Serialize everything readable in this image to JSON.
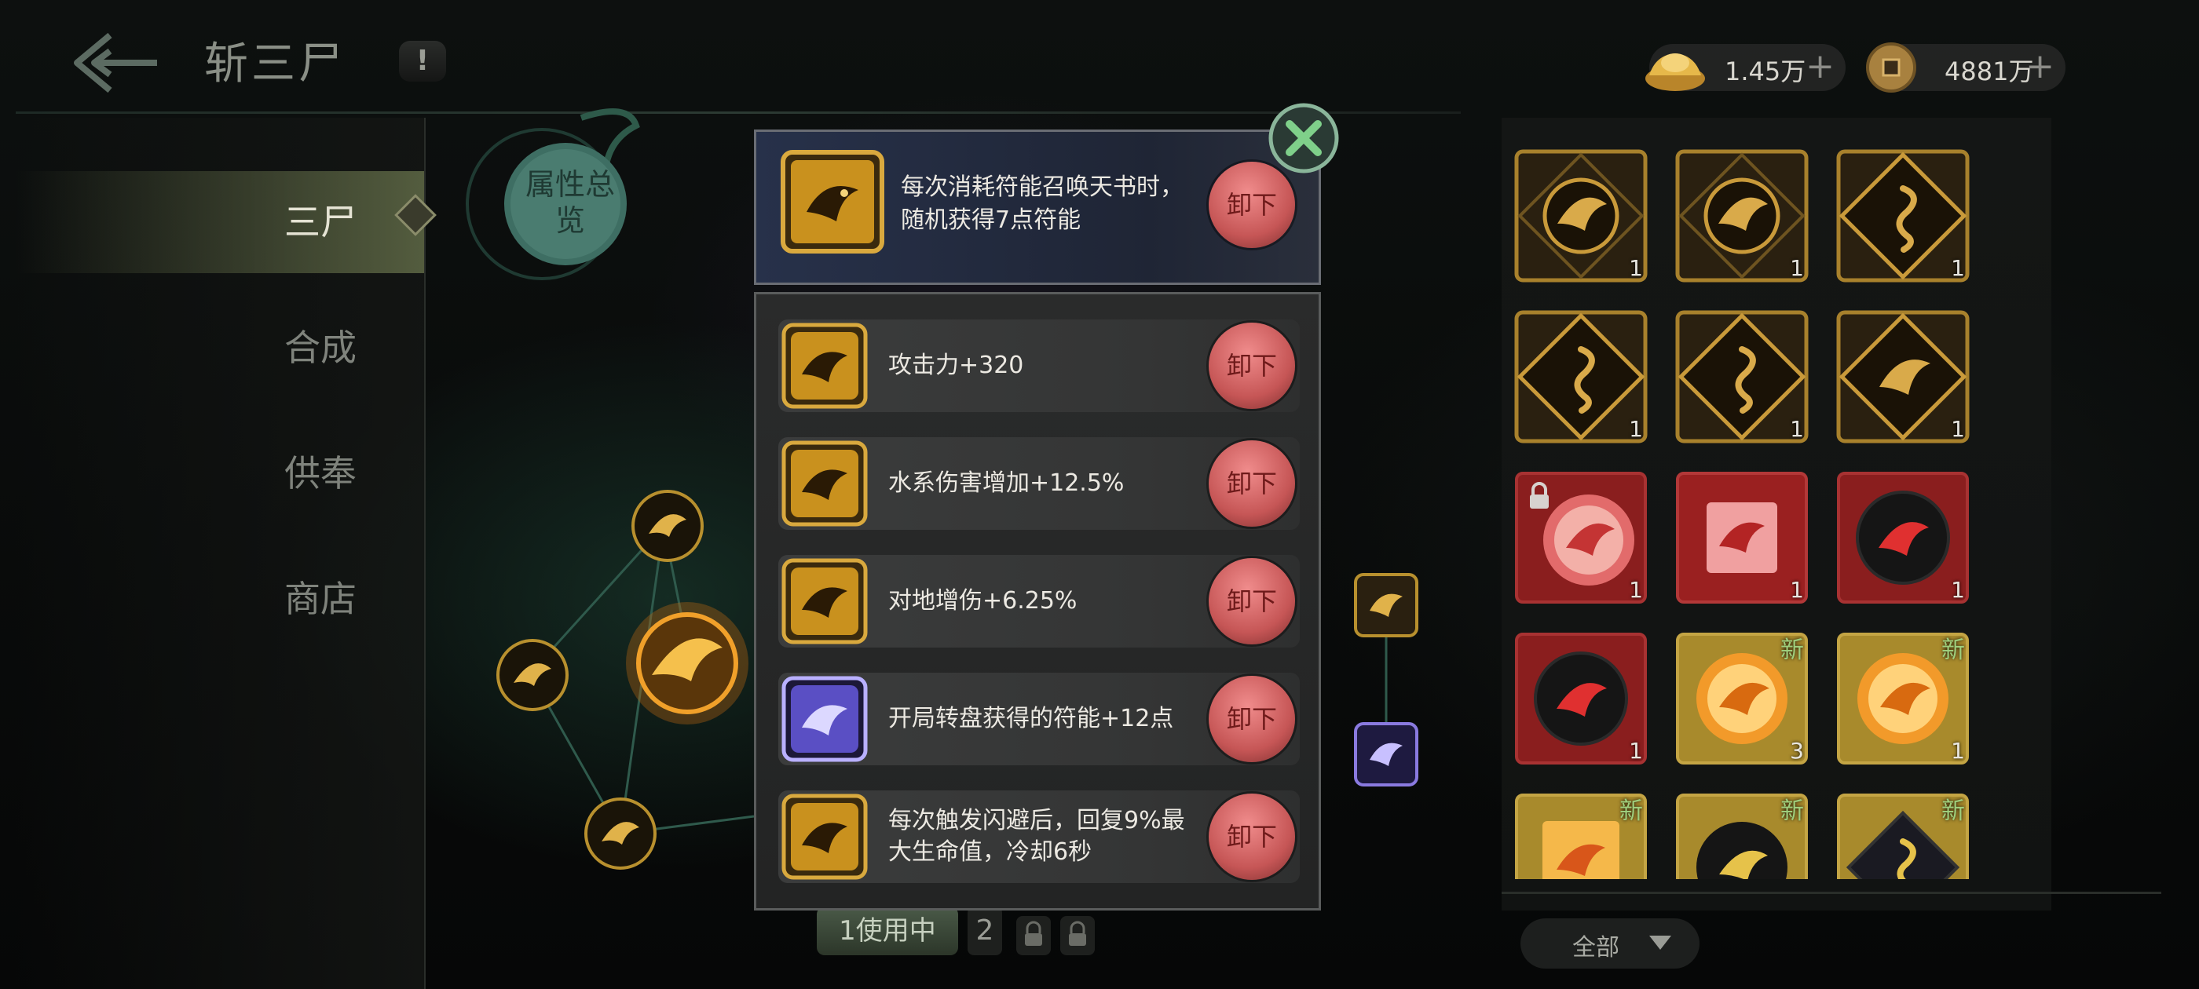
{
  "header": {
    "title": "斩三尸",
    "info_symbol": "!",
    "currencies": [
      {
        "name": "gold-ingot",
        "value": "1.45万"
      },
      {
        "name": "copper-coin",
        "value": "4881万"
      }
    ],
    "plus_symbol": "+"
  },
  "nav": {
    "items": [
      {
        "label": "三尸",
        "active": true
      },
      {
        "label": "合成",
        "active": false
      },
      {
        "label": "供奉",
        "active": false
      },
      {
        "label": "商店",
        "active": false
      }
    ]
  },
  "tree": {
    "badge_label": "属性总览",
    "tabs": {
      "active": "1使用中",
      "second": "2"
    }
  },
  "modal": {
    "top_slot": {
      "desc": "每次消耗符能召唤天书时，随机获得7点符能",
      "button": "卸下",
      "rarity": "gold"
    },
    "runes": [
      {
        "desc": "攻击力+320",
        "button": "卸下",
        "rarity": "gold"
      },
      {
        "desc": "水系伤害增加+12.5%",
        "button": "卸下",
        "rarity": "gold"
      },
      {
        "desc": "对地增伤+6.25%",
        "button": "卸下",
        "rarity": "gold"
      },
      {
        "desc": "开局转盘获得的符能+12点",
        "button": "卸下",
        "rarity": "purple"
      },
      {
        "desc": "每次触发闪避后，回复9%最大生命值，冷却6秒",
        "button": "卸下",
        "rarity": "gold"
      }
    ]
  },
  "inventory": {
    "new_label": "新",
    "filter_label": "全部",
    "items": [
      {
        "type": "gold-bird",
        "count": "1",
        "new": false,
        "locked": false
      },
      {
        "type": "gold-bird",
        "count": "1",
        "new": false,
        "locked": false
      },
      {
        "type": "gold-snake",
        "count": "1",
        "new": false,
        "locked": false
      },
      {
        "type": "gold-snake",
        "count": "1",
        "new": false,
        "locked": false
      },
      {
        "type": "gold-snake",
        "count": "1",
        "new": false,
        "locked": false
      },
      {
        "type": "gold-fish",
        "count": "1",
        "new": false,
        "locked": false
      },
      {
        "type": "red-bird-orb",
        "count": "1",
        "new": false,
        "locked": true
      },
      {
        "type": "red-fish",
        "count": "1",
        "new": false,
        "locked": false
      },
      {
        "type": "red-bird-dark",
        "count": "1",
        "new": false,
        "locked": false
      },
      {
        "type": "red-bird-dark",
        "count": "1",
        "new": false,
        "locked": false
      },
      {
        "type": "yellow-bird-orb",
        "count": "3",
        "new": true,
        "locked": false
      },
      {
        "type": "yellow-bird-orb",
        "count": "1",
        "new": true,
        "locked": false
      },
      {
        "type": "yellow-fish",
        "count": "",
        "new": true,
        "locked": false
      },
      {
        "type": "yellow-bird-dark",
        "count": "",
        "new": true,
        "locked": false
      },
      {
        "type": "yellow-snake-dark",
        "count": "",
        "new": true,
        "locked": false
      }
    ]
  },
  "colors": {
    "accent_green": "#9fcf7d",
    "unload_red": "#d96a6a",
    "gold": "#e0b24a",
    "purple": "#8a7ae0"
  }
}
